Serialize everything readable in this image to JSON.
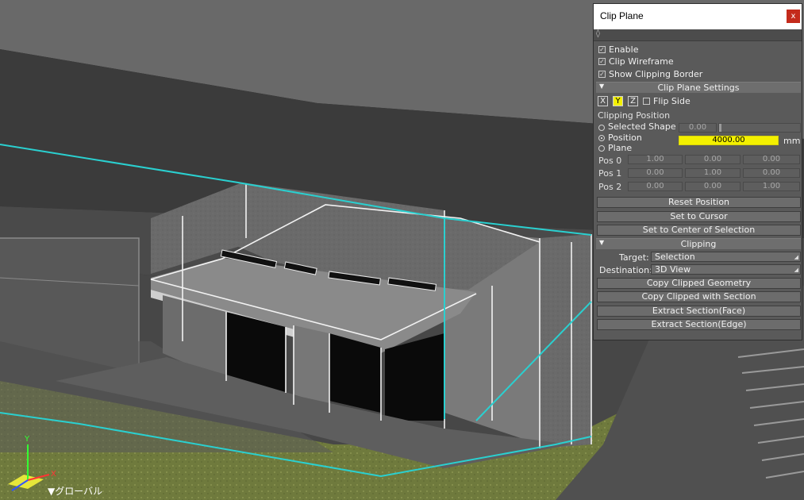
{
  "viewport": {
    "axis_label": "▼グローバル",
    "axis_y": "Y",
    "axis_x": "X"
  },
  "panel": {
    "title": "Clip Plane",
    "close_glyph": "x",
    "pin_glyph": "◊",
    "enable": {
      "label": "Enable",
      "checked": true
    },
    "clip_wireframe": {
      "label": "Clip Wireframe",
      "checked": true
    },
    "show_clipping_border": {
      "label": "Show Clipping Border",
      "checked": true
    },
    "clip_plane_settings": {
      "title": "Clip Plane Settings",
      "axes": [
        {
          "label": "X",
          "selected": false
        },
        {
          "label": "Y",
          "selected": true
        },
        {
          "label": "Z",
          "selected": false
        }
      ],
      "flip_side": {
        "label": "Flip Side",
        "checked": false
      },
      "clipping_position_label": "Clipping Position",
      "selected_shape": {
        "label": "Selected Shape",
        "value": "0.00"
      },
      "position": {
        "label": "Position",
        "value": "4000.00",
        "unit": "mm"
      },
      "plane": {
        "label": "Plane"
      },
      "pos_rows": [
        {
          "label": "Pos 0",
          "values": [
            "1.00",
            "0.00",
            "0.00"
          ]
        },
        {
          "label": "Pos 1",
          "values": [
            "0.00",
            "1.00",
            "0.00"
          ]
        },
        {
          "label": "Pos 2",
          "values": [
            "0.00",
            "0.00",
            "1.00"
          ]
        }
      ],
      "buttons": {
        "reset_position": "Reset Position",
        "set_to_cursor": "Set to Cursor",
        "set_to_center": "Set to Center of Selection"
      }
    },
    "clipping": {
      "title": "Clipping",
      "target_label": "Target:",
      "target_value": "Selection",
      "destination_label": "Destination:",
      "destination_value": "3D View",
      "buttons": {
        "copy_clipped_geometry": "Copy Clipped Geometry",
        "copy_clipped_with_section": "Copy Clipped with Section",
        "extract_section_face": "Extract Section(Face)",
        "extract_section_edge": "Extract Section(Edge)"
      }
    }
  },
  "colors": {
    "accent_yellow": "#f3f000",
    "clip_line": "#2ad0d0",
    "close_red": "#c42b1c"
  }
}
